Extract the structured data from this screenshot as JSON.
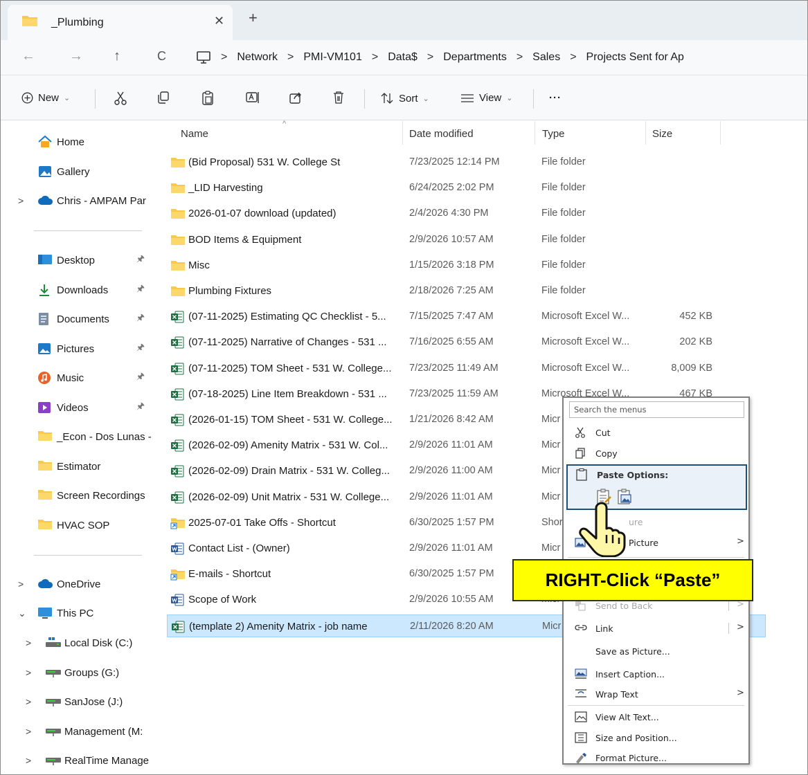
{
  "tab": {
    "title": "_Plumbing",
    "close": "✕",
    "new": "+"
  },
  "nav": {
    "back": "←",
    "forward": "→",
    "up": "↑",
    "refresh": "C",
    "breadcrumb": [
      "Network",
      "PMI-VM101",
      "Data$",
      "Departments",
      "Sales",
      "Projects Sent for Ap"
    ],
    "separator": ">"
  },
  "toolbar": {
    "new_label": "New",
    "sort_label": "Sort",
    "view_label": "View",
    "more_label": "···",
    "chevron": "⌄"
  },
  "sidebar": {
    "top": [
      {
        "label": "Home",
        "icon": "home-icon"
      },
      {
        "label": "Gallery",
        "icon": "gallery-icon"
      },
      {
        "label": "Chris - AMPAM Par",
        "icon": "cloud-icon",
        "caret": ">"
      }
    ],
    "pinned": [
      {
        "label": "Desktop",
        "icon": "desktop-icon",
        "pin": "📌"
      },
      {
        "label": "Downloads",
        "icon": "download-icon",
        "pin": "📌"
      },
      {
        "label": "Documents",
        "icon": "documents-icon",
        "pin": "📌"
      },
      {
        "label": "Pictures",
        "icon": "pictures-icon",
        "pin": "📌"
      },
      {
        "label": "Music",
        "icon": "music-icon",
        "pin": "📌"
      },
      {
        "label": "Videos",
        "icon": "videos-icon",
        "pin": "📌"
      },
      {
        "label": "_Econ - Dos Lunas -",
        "icon": "folder-icon"
      },
      {
        "label": "Estimator",
        "icon": "folder-icon"
      },
      {
        "label": "Screen Recordings",
        "icon": "folder-icon"
      },
      {
        "label": "HVAC SOP",
        "icon": "folder-icon"
      }
    ],
    "bottom": [
      {
        "label": "OneDrive",
        "icon": "cloud-icon",
        "caret": ">"
      },
      {
        "label": "This PC",
        "icon": "pc-icon",
        "caret": "⌄"
      },
      {
        "label": "Local Disk (C:)",
        "icon": "disk-icon",
        "caret": ">"
      },
      {
        "label": "Groups (G:)",
        "icon": "network-drive-icon",
        "caret": ">"
      },
      {
        "label": "SanJose (J:)",
        "icon": "network-drive-icon",
        "caret": ">"
      },
      {
        "label": "Management (M:",
        "icon": "network-drive-icon",
        "caret": ">"
      },
      {
        "label": "RealTime Manage",
        "icon": "network-drive-icon",
        "caret": ">"
      }
    ]
  },
  "columns": {
    "name": "Name",
    "date": "Date modified",
    "type": "Type",
    "size": "Size",
    "sort_caret": "^"
  },
  "files": [
    {
      "name": "(Bid Proposal) 531 W. College St",
      "date": "7/23/2025 12:14 PM",
      "type": "File folder",
      "size": "",
      "icon": "folder-icon"
    },
    {
      "name": "_LID Harvesting",
      "date": "6/24/2025 2:02 PM",
      "type": "File folder",
      "size": "",
      "icon": "folder-icon"
    },
    {
      "name": "2026-01-07 download (updated)",
      "date": "2/4/2026 4:30 PM",
      "type": "File folder",
      "size": "",
      "icon": "folder-icon"
    },
    {
      "name": "BOD Items & Equipment",
      "date": "2/9/2026 10:57 AM",
      "type": "File folder",
      "size": "",
      "icon": "folder-icon"
    },
    {
      "name": "Misc",
      "date": "1/15/2026 3:18 PM",
      "type": "File folder",
      "size": "",
      "icon": "folder-icon"
    },
    {
      "name": "Plumbing Fixtures",
      "date": "2/18/2026 7:25 AM",
      "type": "File folder",
      "size": "",
      "icon": "folder-icon"
    },
    {
      "name": "(07-11-2025) Estimating QC Checklist - 5...",
      "date": "7/15/2025 7:47 AM",
      "type": "Microsoft Excel W...",
      "size": "452 KB",
      "icon": "excel-icon"
    },
    {
      "name": "(07-11-2025) Narrative of Changes - 531 ...",
      "date": "7/16/2025 6:55 AM",
      "type": "Microsoft Excel W...",
      "size": "202 KB",
      "icon": "excel-icon"
    },
    {
      "name": "(07-11-2025) TOM Sheet - 531 W. College...",
      "date": "7/23/2025 11:49 AM",
      "type": "Microsoft Excel W...",
      "size": "8,009 KB",
      "icon": "excel-icon"
    },
    {
      "name": "(07-18-2025) Line Item Breakdown - 531 ...",
      "date": "7/23/2025 11:59 AM",
      "type": "Microsoft Excel W...",
      "size": "467 KB",
      "icon": "excel-icon"
    },
    {
      "name": "(2026-01-15) TOM Sheet - 531 W. College...",
      "date": "1/21/2026 8:42 AM",
      "type": "Micr",
      "size": "",
      "icon": "excel-icon"
    },
    {
      "name": "(2026-02-09) Amenity Matrix - 531 W. Col...",
      "date": "2/9/2026 11:01 AM",
      "type": "Micr",
      "size": "",
      "icon": "excel-icon"
    },
    {
      "name": "(2026-02-09) Drain Matrix - 531 W. Colleg...",
      "date": "2/9/2026 11:00 AM",
      "type": "Micr",
      "size": "",
      "icon": "excel-icon"
    },
    {
      "name": "(2026-02-09) Unit Matrix - 531 W. College...",
      "date": "2/9/2026 11:01 AM",
      "type": "Micr",
      "size": "",
      "icon": "excel-icon"
    },
    {
      "name": "2025-07-01 Take Offs - Shortcut",
      "date": "6/30/2025 1:57 PM",
      "type": "Shor",
      "size": "",
      "icon": "shortcut-folder-icon"
    },
    {
      "name": "Contact List - (Owner)",
      "date": "2/9/2026 11:01 AM",
      "type": "Micr",
      "size": "",
      "icon": "word-icon"
    },
    {
      "name": "E-mails - Shortcut",
      "date": "6/30/2025 1:57 PM",
      "type": "",
      "size": "",
      "icon": "shortcut-folder-icon"
    },
    {
      "name": "Scope of Work",
      "date": "2/9/2026 10:55 AM",
      "type": "Micr",
      "size": "",
      "icon": "word-icon"
    },
    {
      "name": "(template 2) Amenity Matrix - job name",
      "date": "2/11/2026 8:20 AM",
      "type": "Micr",
      "size": "",
      "icon": "excel-icon",
      "selected": true
    }
  ],
  "context_menu": {
    "search_placeholder": "Search the menus",
    "cut": "Cut",
    "copy": "Copy",
    "paste_options": "Paste Options:",
    "partial_item": "ure",
    "change_picture": "Picture",
    "send_to_back": "Send to Back",
    "link": "Link",
    "save_as_picture": "Save as Picture...",
    "insert_caption": "Insert Caption...",
    "wrap_text": "Wrap Text",
    "view_alt_text": "View Alt Text...",
    "size_and_position": "Size and Position...",
    "format_picture": "Format Picture...",
    "arrow": ">"
  },
  "callout": {
    "text": "RIGHT-Click “Paste”"
  },
  "colors": {
    "accent": "#1f4e79",
    "selection": "#cce8ff",
    "callout": "#ffff00",
    "folder": "#f8c94a",
    "excel": "#1d6f42",
    "word": "#2b579a"
  }
}
